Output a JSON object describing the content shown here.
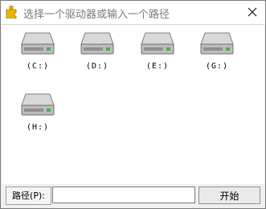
{
  "window": {
    "title": "选择一个驱动器或输入一个路径",
    "app_icon": "puzzle-icon",
    "close_icon": "close-icon"
  },
  "drives": [
    {
      "label": "(C:)",
      "icon": "drive-icon"
    },
    {
      "label": "(D:)",
      "icon": "drive-icon"
    },
    {
      "label": "(E:)",
      "icon": "drive-icon"
    },
    {
      "label": "(G:)",
      "icon": "drive-icon"
    },
    {
      "label": "(H:)",
      "icon": "drive-icon"
    }
  ],
  "pathbar": {
    "label": "路径(P):",
    "input_value": "",
    "start_button": "开始"
  },
  "colors": {
    "title_text": "#7a7a7a",
    "icon_yellow": "#e8b400"
  }
}
